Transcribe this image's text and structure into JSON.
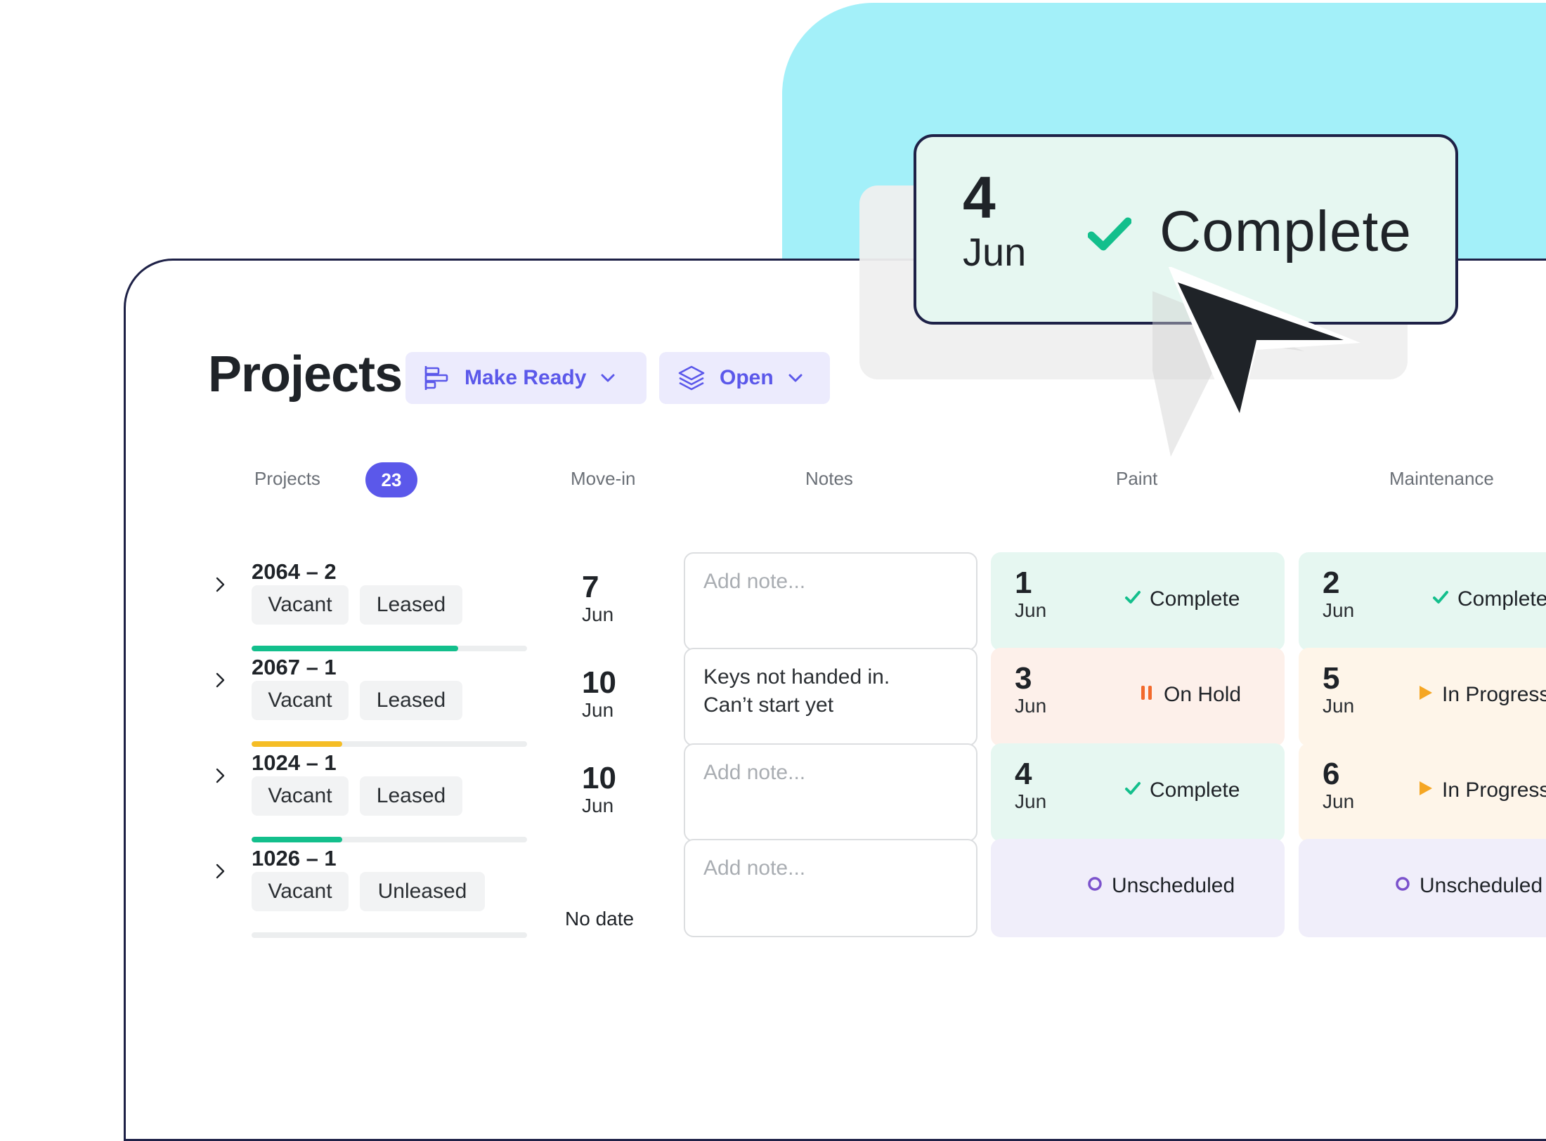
{
  "header": {
    "title": "Projects",
    "filters": [
      {
        "label": "Make Ready",
        "icon": "gantt-icon"
      },
      {
        "label": "Open",
        "icon": "layers-icon"
      }
    ]
  },
  "columns": {
    "projects": "Projects",
    "projects_count": "23",
    "movein": "Move-in",
    "notes": "Notes",
    "paint": "Paint",
    "maintenance": "Maintenance"
  },
  "rows": [
    {
      "id": "2064 – 2",
      "tags": [
        "Vacant",
        "Leased"
      ],
      "progress": 0.75,
      "progress_color": "#13bf8c",
      "movein": {
        "day": "7",
        "month": "Jun"
      },
      "note": {
        "text": "Add note...",
        "placeholder": true
      },
      "paint": {
        "day": "1",
        "month": "Jun",
        "status": "Complete"
      },
      "maintenance": {
        "day": "2",
        "month": "Jun",
        "status": "Complete"
      }
    },
    {
      "id": "2067 – 1",
      "tags": [
        "Vacant",
        "Leased"
      ],
      "progress": 0.33,
      "progress_color": "#f5bd25",
      "movein": {
        "day": "10",
        "month": "Jun"
      },
      "note": {
        "text": "Keys not handed in.\nCan’t start yet",
        "placeholder": false
      },
      "paint": {
        "day": "3",
        "month": "Jun",
        "status": "On Hold"
      },
      "maintenance": {
        "day": "5",
        "month": "Jun",
        "status": "In Progress"
      }
    },
    {
      "id": "1024 – 1",
      "tags": [
        "Vacant",
        "Leased"
      ],
      "progress": 0.33,
      "progress_color": "#13bf8c",
      "movein": {
        "day": "10",
        "month": "Jun"
      },
      "note": {
        "text": "Add note...",
        "placeholder": true
      },
      "paint": {
        "day": "4",
        "month": "Jun",
        "status": "Complete"
      },
      "maintenance": {
        "day": "6",
        "month": "Jun",
        "status": "In Progress"
      }
    },
    {
      "id": "1026 – 1",
      "tags": [
        "Vacant",
        "Unleased"
      ],
      "progress": 0,
      "progress_color": "#13bf8c",
      "movein": {
        "nodate": "No date"
      },
      "note": {
        "text": "Add note...",
        "placeholder": true
      },
      "paint": {
        "status": "Unscheduled"
      },
      "maintenance": {
        "status": "Unscheduled"
      }
    }
  ],
  "tooltip": {
    "day": "4",
    "month": "Jun",
    "status": "Complete"
  },
  "colors": {
    "accent": "#5b58ea",
    "complete": "#13bf8c",
    "on_hold": "#f26a2c",
    "in_progress": "#f5a623",
    "unscheduled": "#7b52cc",
    "cyan": "#a3f0f9"
  }
}
